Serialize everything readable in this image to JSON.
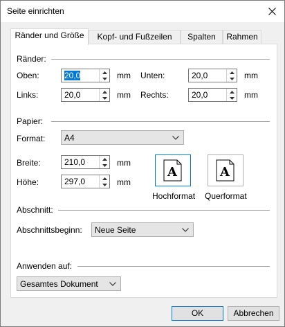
{
  "window": {
    "title": "Seite einrichten"
  },
  "tabs": [
    "Ränder und Größe",
    "Kopf- und Fußzeilen",
    "Spalten",
    "Rahmen"
  ],
  "margins": {
    "group_label": "Ränder:",
    "top_label": "Oben:",
    "top_value": "20,0",
    "left_label": "Links:",
    "left_value": "20,0",
    "bottom_label": "Unten:",
    "bottom_value": "20,0",
    "right_label": "Rechts:",
    "right_value": "20,0",
    "unit": "mm"
  },
  "paper": {
    "group_label": "Papier:",
    "format_label": "Format:",
    "format_value": "A4",
    "width_label": "Breite:",
    "width_value": "210,0",
    "height_label": "Höhe:",
    "height_value": "297,0",
    "unit": "mm",
    "portrait_label": "Hochformat",
    "landscape_label": "Querformat",
    "orientation_glyph": "A"
  },
  "section": {
    "group_label": "Abschnitt:",
    "start_label": "Abschnittsbeginn:",
    "start_value": "Neue Seite"
  },
  "apply": {
    "label": "Anwenden auf:",
    "value": "Gesamtes Dokument"
  },
  "buttons": {
    "ok": "OK",
    "cancel": "Abbrechen"
  },
  "colors": {
    "accent": "#0078d7",
    "selection": "#0078d7"
  }
}
